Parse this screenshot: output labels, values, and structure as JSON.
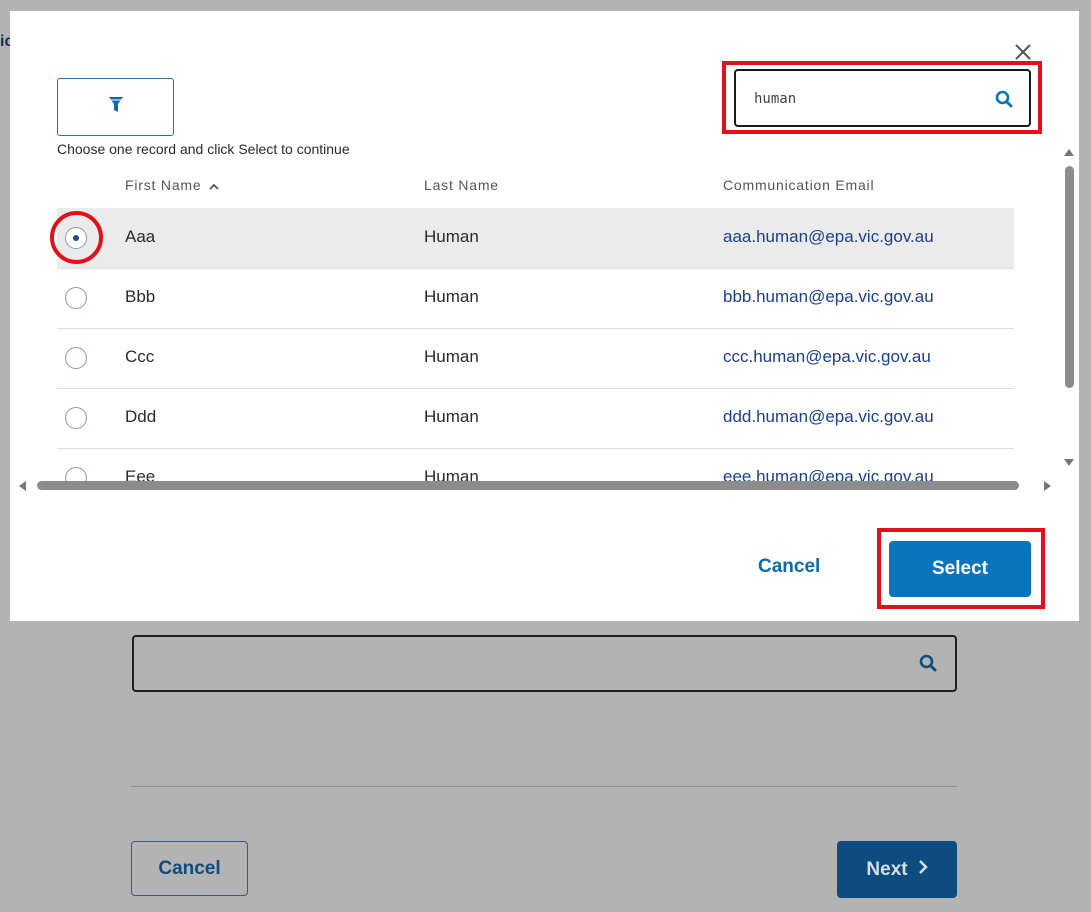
{
  "background": {
    "edge_text": "ic",
    "search_icon": "search-icon",
    "cancel_label": "Cancel",
    "next_label": "Next"
  },
  "modal": {
    "close_icon": "close-icon",
    "filter_icon": "filter-icon",
    "instruction": "Choose one record and click Select to continue",
    "search": {
      "value": "human",
      "icon": "search-icon"
    },
    "table": {
      "columns": [
        "First Name",
        "Last Name",
        "Communication Email"
      ],
      "sort_indicator": "^",
      "rows": [
        {
          "first": "Aaa",
          "last": "Human",
          "email": "aaa.human@epa.vic.gov.au",
          "selected": true
        },
        {
          "first": "Bbb",
          "last": "Human",
          "email": "bbb.human@epa.vic.gov.au",
          "selected": false
        },
        {
          "first": "Ccc",
          "last": "Human",
          "email": "ccc.human@epa.vic.gov.au",
          "selected": false
        },
        {
          "first": "Ddd",
          "last": "Human",
          "email": "ddd.human@epa.vic.gov.au",
          "selected": false
        },
        {
          "first": "Eee",
          "last": "Human",
          "email": "eee.human@epa.vic.gov.au",
          "selected": false
        }
      ]
    },
    "cancel_label": "Cancel",
    "select_label": "Select"
  },
  "colors": {
    "highlight": "#e3101b",
    "primary": "#0a74bd",
    "link": "#1c3f8a"
  }
}
